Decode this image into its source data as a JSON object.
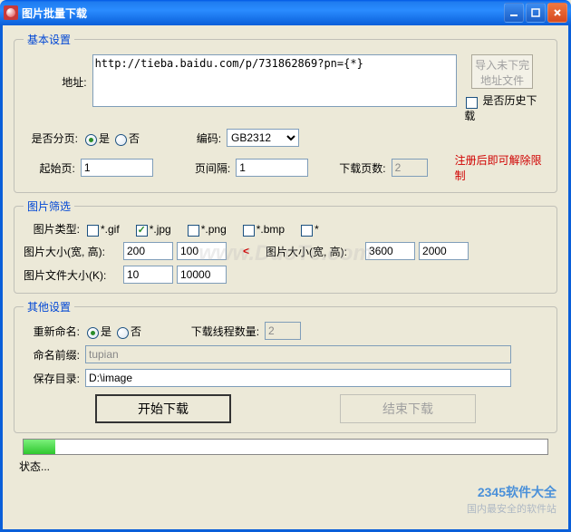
{
  "window": {
    "title": "图片批量下载"
  },
  "basic": {
    "legend": "基本设置",
    "addr_label": "地址:",
    "addr_value": "http://tieba.baidu.com/p/731862869?pn={*}",
    "import_button": "导入未下完\n地址文件",
    "history_download": "是否历史下载",
    "paging_label": "是否分页:",
    "radio_yes": "是",
    "radio_no": "否",
    "encoding_label": "编码:",
    "encoding_value": "GB2312",
    "start_page_label": "起始页:",
    "start_page_value": "1",
    "interval_label": "页间隔:",
    "interval_value": "1",
    "page_count_label": "下载页数:",
    "page_count_value": "2",
    "register_note": "注册后即可解除限制"
  },
  "filter": {
    "legend": "图片筛选",
    "type_label": "图片类型:",
    "gif": "*.gif",
    "jpg": "*.jpg",
    "png": "*.png",
    "bmp": "*.bmp",
    "any": "*",
    "size_label": "图片大小(宽, 高):",
    "min_w": "200",
    "min_h": "100",
    "lt": "<",
    "size_label2": "图片大小(宽, 高):",
    "max_w": "3600",
    "max_h": "2000",
    "filesize_label": "图片文件大小(K):",
    "fs_min": "10",
    "fs_max": "10000"
  },
  "other": {
    "legend": "其他设置",
    "rename_label": "重新命名:",
    "radio_yes": "是",
    "radio_no": "否",
    "threads_label": "下载线程数量:",
    "threads_value": "2",
    "prefix_label": "命名前缀:",
    "prefix_value": "tupian",
    "savedir_label": "保存目录:",
    "savedir_value": "D:\\image"
  },
  "actions": {
    "start": "开始下载",
    "stop": "结束下载"
  },
  "status": {
    "label": "状态..."
  },
  "watermark": "www.DuoTe.com",
  "footer": {
    "brand": "2345软件大全",
    "sub": "国内最安全的软件站"
  }
}
